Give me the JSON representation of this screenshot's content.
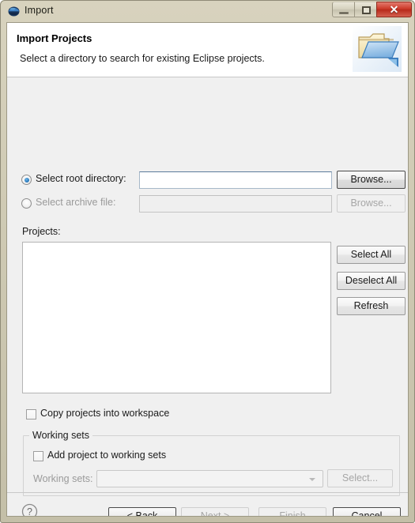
{
  "window": {
    "title": "Import",
    "icon": "eclipse-icon",
    "controls": {
      "minimize": "minimize-icon",
      "maximize": "restore-icon",
      "close": "✕"
    }
  },
  "header": {
    "title": "Import Projects",
    "subtitle": "Select a directory to search for existing Eclipse projects.",
    "icon": "import-folder-icon"
  },
  "source": {
    "root_directory": {
      "label": "Select root directory:",
      "selected": true,
      "value": "",
      "placeholder": "",
      "browse_label": "Browse..."
    },
    "archive_file": {
      "label": "Select archive file:",
      "selected": false,
      "value": "",
      "placeholder": "",
      "browse_label": "Browse...",
      "disabled": true
    }
  },
  "projects": {
    "label": "Projects:",
    "items": [],
    "buttons": {
      "select_all": "Select All",
      "deselect_all": "Deselect All",
      "refresh": "Refresh"
    }
  },
  "options": {
    "copy_projects": {
      "label": "Copy projects into workspace",
      "checked": false
    }
  },
  "working_sets": {
    "group_label": "Working sets",
    "add_checkbox": {
      "label": "Add project to working sets",
      "checked": false
    },
    "combo_label": "Working sets:",
    "combo_value": "",
    "combo_options": [],
    "select_label": "Select...",
    "disabled": true
  },
  "footer": {
    "help": "help-icon",
    "back": "< Back",
    "next": "Next >",
    "finish": "Finish",
    "cancel": "Cancel"
  },
  "colors": {
    "frame": "#cfcab4",
    "dialog_bg": "#f0f0f0",
    "header_bg": "#ffffff",
    "close_button": "#cd3a29",
    "accent": "#2b7bbd"
  }
}
